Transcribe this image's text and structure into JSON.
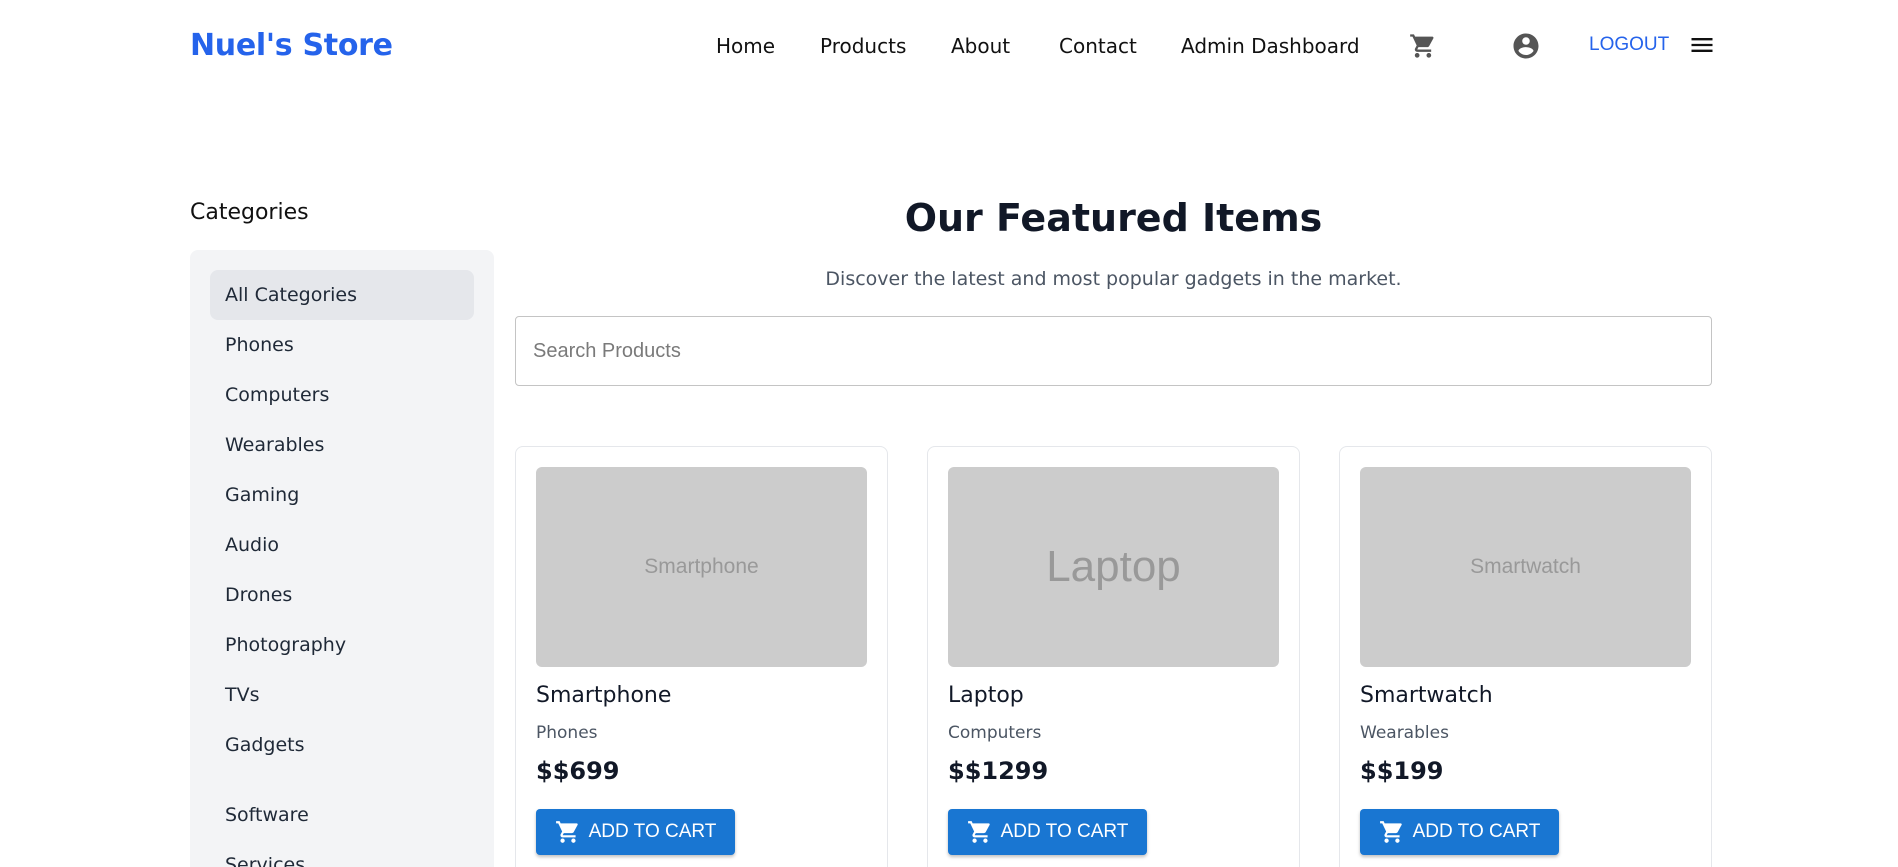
{
  "header": {
    "brand": "Nuel's Store",
    "nav": [
      "Home",
      "Products",
      "About",
      "Contact",
      "Admin Dashboard"
    ],
    "cart_icon": "cart-icon",
    "account_icon": "account-circle-icon",
    "logout": "LOGOUT",
    "menu_icon": "hamburger-menu-icon"
  },
  "sidebar": {
    "title": "Categories",
    "items": [
      {
        "label": "All Categories",
        "active": true
      },
      {
        "label": "Phones"
      },
      {
        "label": "Computers"
      },
      {
        "label": "Wearables"
      },
      {
        "label": "Gaming"
      },
      {
        "label": "Audio"
      },
      {
        "label": "Drones"
      },
      {
        "label": "Photography"
      },
      {
        "label": "TVs"
      },
      {
        "label": "Gadgets"
      },
      {
        "label": "Software"
      },
      {
        "label": "Services"
      }
    ]
  },
  "main": {
    "title": "Our Featured Items",
    "subtitle": "Discover the latest and most popular gadgets in the market.",
    "search_placeholder": "Search Products",
    "search_value": "",
    "products": [
      {
        "image_text": "Smartphone",
        "name": "Smartphone",
        "category": "Phones",
        "price": "$$699",
        "button": "ADD TO CART"
      },
      {
        "image_text": "Laptop",
        "name": "Laptop",
        "category": "Computers",
        "price": "$$1299",
        "button": "ADD TO CART"
      },
      {
        "image_text": "Smartwatch",
        "name": "Smartwatch",
        "category": "Wearables",
        "price": "$$199",
        "button": "ADD TO CART"
      }
    ]
  },
  "colors": {
    "brand": "#2563eb",
    "button": "#1976d2",
    "sidebar_bg": "#f3f4f6",
    "placeholder_bg": "#cccccc"
  }
}
